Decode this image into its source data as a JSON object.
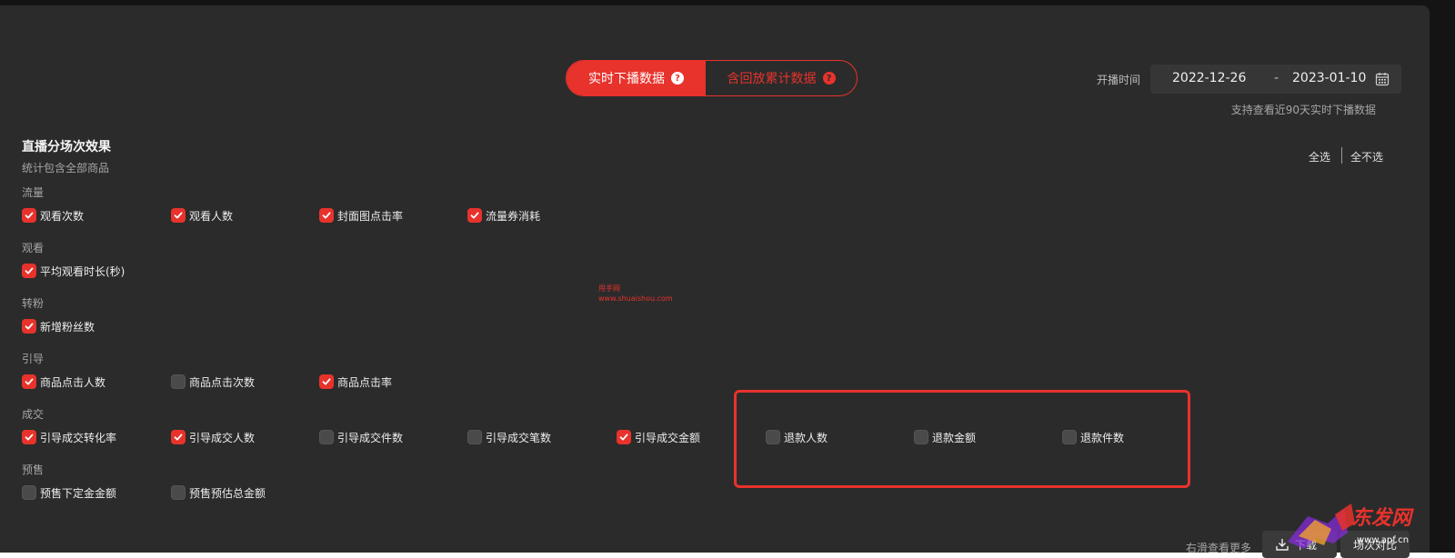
{
  "colors": {
    "accent": "#e8322c",
    "panel": "#2b2b2b"
  },
  "toggle": {
    "active": {
      "label": "实时下播数据",
      "icon": "question-icon"
    },
    "inactive": {
      "label": "含回放累计数据",
      "icon": "question-icon"
    },
    "icon_glyph": "?"
  },
  "date": {
    "label": "开播时间",
    "start": "2022-12-26",
    "separator": "-",
    "end": "2023-01-10",
    "icon": "calendar-icon",
    "hint": "支持查看近90天实时下播数据"
  },
  "section": {
    "title": "直播分场次效果",
    "subtitle": "统计包含全部商品",
    "select_all": "全选",
    "select_none": "全不选"
  },
  "groups": [
    {
      "label": "流量",
      "items": [
        {
          "label": "观看次数",
          "checked": true
        },
        {
          "label": "观看人数",
          "checked": true
        },
        {
          "label": "封面图点击率",
          "checked": true
        },
        {
          "label": "流量券消耗",
          "checked": true
        }
      ]
    },
    {
      "label": "观看",
      "items": [
        {
          "label": "平均观看时长(秒)",
          "checked": true
        }
      ]
    },
    {
      "label": "转粉",
      "items": [
        {
          "label": "新增粉丝数",
          "checked": true
        }
      ]
    },
    {
      "label": "引导",
      "items": [
        {
          "label": "商品点击人数",
          "checked": true
        },
        {
          "label": "商品点击次数",
          "checked": false
        },
        {
          "label": "商品点击率",
          "checked": true
        }
      ]
    },
    {
      "label": "成交",
      "items": [
        {
          "label": "引导成交转化率",
          "checked": true
        },
        {
          "label": "引导成交人数",
          "checked": true
        },
        {
          "label": "引导成交件数",
          "checked": false
        },
        {
          "label": "引导成交笔数",
          "checked": false
        },
        {
          "label": "引导成交金额",
          "checked": true
        },
        {
          "label": "退款人数",
          "checked": false
        },
        {
          "label": "退款金额",
          "checked": false
        },
        {
          "label": "退款件数",
          "checked": false
        }
      ]
    },
    {
      "label": "预售",
      "items": [
        {
          "label": "预售下定金金额",
          "checked": false
        },
        {
          "label": "预售预估总金额",
          "checked": false
        }
      ]
    }
  ],
  "watermark": {
    "line1": "甩手网",
    "line2": "www.shuaishou.com"
  },
  "bottom": {
    "more_text": "右滑查看更多",
    "download_label": "下载",
    "download_icon": "download-icon",
    "compare_label": "场次对比"
  },
  "logo": {
    "text": "东发网",
    "url": "www.apf.cn"
  }
}
